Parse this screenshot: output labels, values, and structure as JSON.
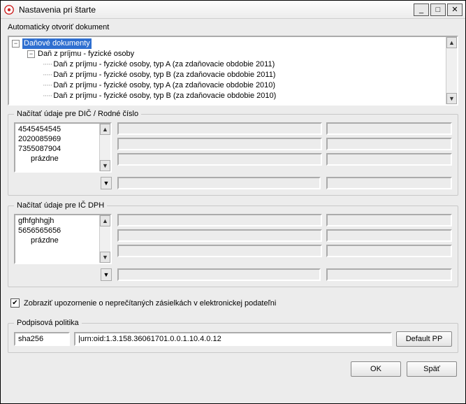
{
  "window": {
    "title": "Nastavenia pri štarte",
    "min_glyph": "_",
    "max_glyph": "□",
    "close_glyph": "✕"
  },
  "auto_open": {
    "label": "Automaticky otvoriť dokument",
    "tree": {
      "root": "Daňové dokumenty",
      "child1": "Daň z príjmu - fyzické osoby",
      "leaves": [
        "Daň z príjmu - fyzické osoby, typ A (za zdaňovacie obdobie 2011)",
        "Daň z príjmu - fyzické osoby, typ B (za zdaňovacie obdobie 2011)",
        "Daň z príjmu - fyzické osoby, typ A (za zdaňovacie obdobie 2010)",
        "Daň z príjmu - fyzické osoby, typ B (za zdaňovacie obdobie 2010)"
      ]
    }
  },
  "dic_section": {
    "legend": "Načítať údaje pre DIČ / Rodné číslo",
    "items": [
      "4545454545",
      "2020085969",
      "7355087904"
    ],
    "empty_label": "prázdne"
  },
  "icdph_section": {
    "legend": "Načítať údaje pre IČ DPH",
    "items": [
      "gfhfghhgjh",
      "5656565656"
    ],
    "empty_label": "prázdne"
  },
  "notify": {
    "checked": true,
    "label": "Zobraziť upozornenie o neprečítaných zásielkách v elektronickej podateľni"
  },
  "policy": {
    "legend": "Podpisová politika",
    "hash": "sha256",
    "urn": "|urn:oid:1.3.158.36061701.0.0.1.10.4.0.12",
    "default_btn": "Default PP"
  },
  "buttons": {
    "ok": "OK",
    "back": "Späť"
  },
  "glyphs": {
    "up": "▲",
    "down": "▼",
    "minus": "−",
    "check": "✔"
  }
}
